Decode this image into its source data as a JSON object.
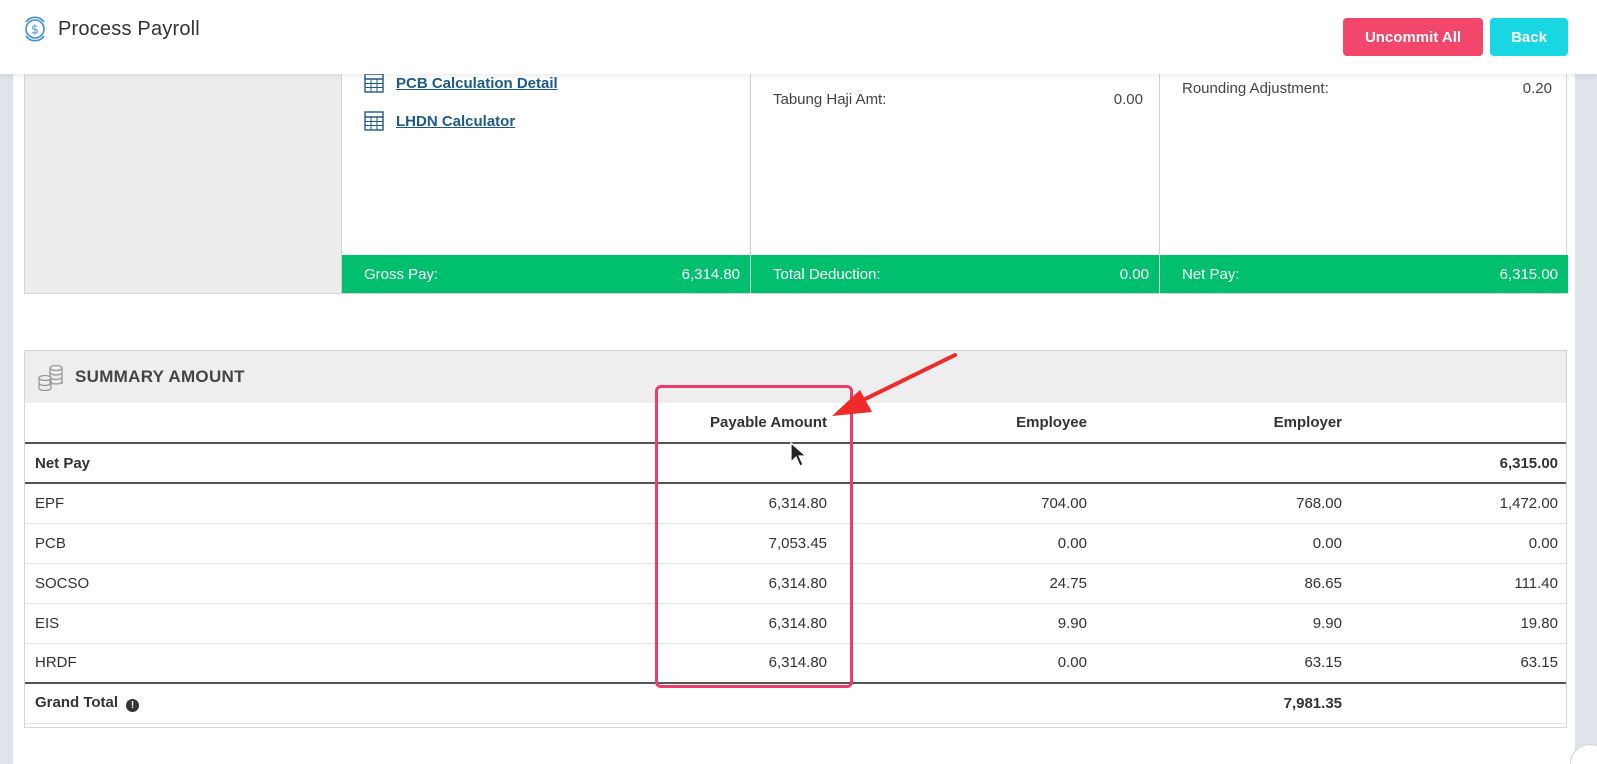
{
  "header": {
    "title": "Process Payroll",
    "uncommit_label": "Uncommit All",
    "back_label": "Back"
  },
  "top_card": {
    "links": [
      {
        "label": "PCB Calculation Detail",
        "icon": "calculator-icon"
      },
      {
        "label": "LHDN Calculator",
        "icon": "calculator-icon"
      }
    ],
    "tabung_haji": {
      "label": "Tabung Haji Amt:",
      "value": "0.00"
    },
    "rounding": {
      "label": "Rounding Adjustment:",
      "value": "0.20"
    },
    "gross_pay": {
      "label": "Gross Pay:",
      "value": "6,314.80"
    },
    "total_deduction": {
      "label": "Total Deduction:",
      "value": "0.00"
    },
    "net_pay": {
      "label": "Net Pay:",
      "value": "6,315.00"
    }
  },
  "summary": {
    "title": "SUMMARY AMOUNT",
    "columns": [
      "Payable Amount",
      "Employee",
      "Employer"
    ],
    "net_pay_row": {
      "label": "Net Pay",
      "total": "6,315.00"
    },
    "rows": [
      {
        "label": "EPF",
        "payable": "6,314.80",
        "employee": "704.00",
        "employer": "768.00",
        "total": "1,472.00"
      },
      {
        "label": "PCB",
        "payable": "7,053.45",
        "employee": "0.00",
        "employer": "0.00",
        "total": "0.00"
      },
      {
        "label": "SOCSO",
        "payable": "6,314.80",
        "employee": "24.75",
        "employer": "86.65",
        "total": "111.40"
      },
      {
        "label": "EIS",
        "payable": "6,314.80",
        "employee": "9.90",
        "employer": "9.90",
        "total": "19.80"
      },
      {
        "label": "HRDF",
        "payable": "6,314.80",
        "employee": "0.00",
        "employer": "63.15",
        "total": "63.15"
      }
    ],
    "grand_total": {
      "label": "Grand Total",
      "employer": "7,981.35",
      "info_glyph": "!"
    }
  },
  "colors": {
    "accent_pink": "#f2466a",
    "accent_cyan": "#19d6e3",
    "green": "#00c070",
    "annotation": "#ec3d6a"
  }
}
